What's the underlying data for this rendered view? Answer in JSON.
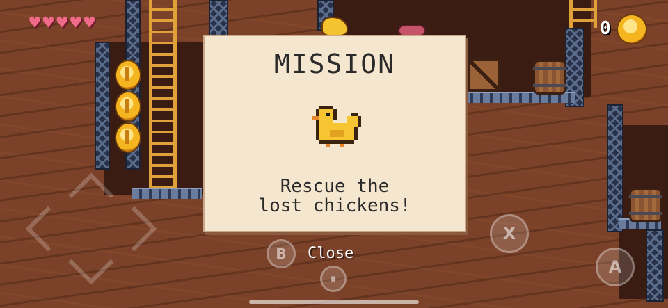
{
  "hud": {
    "hearts": [
      "♥",
      "♥",
      "♥",
      "♥",
      "♥"
    ],
    "coin_count": "0",
    "heart_color": "#f06a8a"
  },
  "dialog": {
    "title": "MISSION",
    "icon": "chicken-icon",
    "message": "Rescue the\nlost chickens!"
  },
  "controls": {
    "dpad": "d-pad",
    "b_button": "B",
    "close_label": "Close",
    "pause_button": "⏸",
    "x_button": "X",
    "a_button": "A"
  },
  "colors": {
    "parchment": "#f5e6cf",
    "dirt": "#7b4229",
    "girder": "#27324a",
    "coin": "#f5b520"
  }
}
